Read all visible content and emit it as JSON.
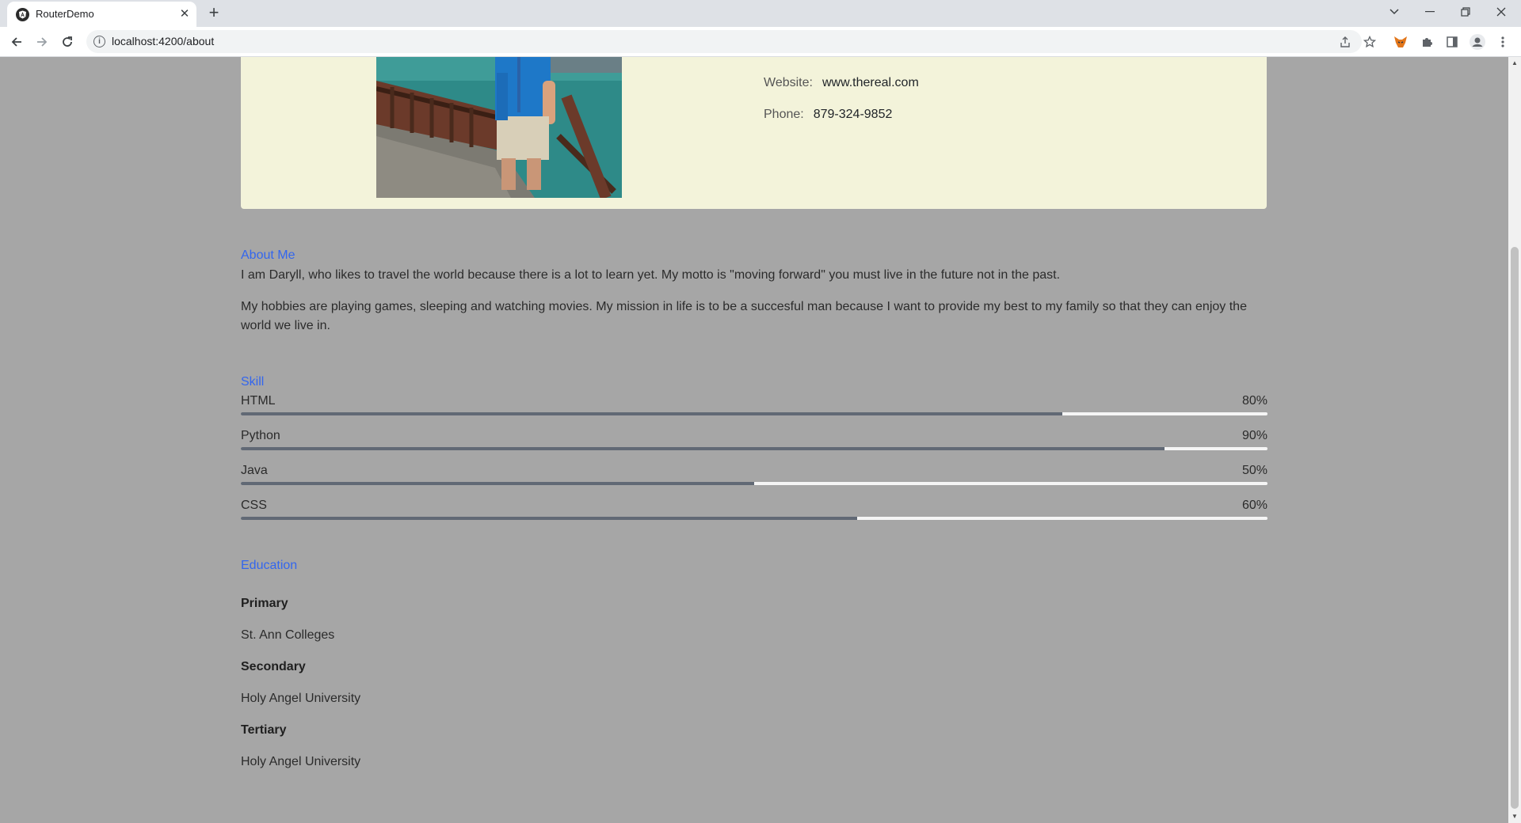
{
  "browser": {
    "tab_title": "RouterDemo",
    "url": "localhost:4200/about"
  },
  "profile": {
    "website_label": "Website:",
    "website_value": "www.thereal.com",
    "phone_label": "Phone:",
    "phone_value": "879-324-9852"
  },
  "about": {
    "title": "About Me",
    "paragraph1": "I am Daryll, who likes to travel the world because there is a lot to learn yet. My motto is \"moving forward\" you must live in the future not in the past.",
    "paragraph2": "My hobbies are playing games, sleeping and watching movies. My mission in life is to be a succesful man because I want to provide my best to my family so that they can enjoy the world we live in."
  },
  "skills": {
    "title": "Skill",
    "items": [
      {
        "name": "HTML",
        "percent_label": "80%",
        "level": 0.8
      },
      {
        "name": "Python",
        "percent_label": "90%",
        "level": 0.9
      },
      {
        "name": "Java",
        "percent_label": "50%",
        "level": 0.5
      },
      {
        "name": "CSS",
        "percent_label": "60%",
        "level": 0.6
      }
    ]
  },
  "education": {
    "title": "Education",
    "items": [
      {
        "level": "Primary",
        "school": "St. Ann Colleges"
      },
      {
        "level": "Secondary",
        "school": "Holy Angel University"
      },
      {
        "level": "Tertiary",
        "school": "Holy Angel University"
      }
    ]
  },
  "colors": {
    "page_bg": "#a6a6a6",
    "card_bg": "#f3f3da",
    "section_title": "#3366ee",
    "skill_fill": "#616975"
  }
}
